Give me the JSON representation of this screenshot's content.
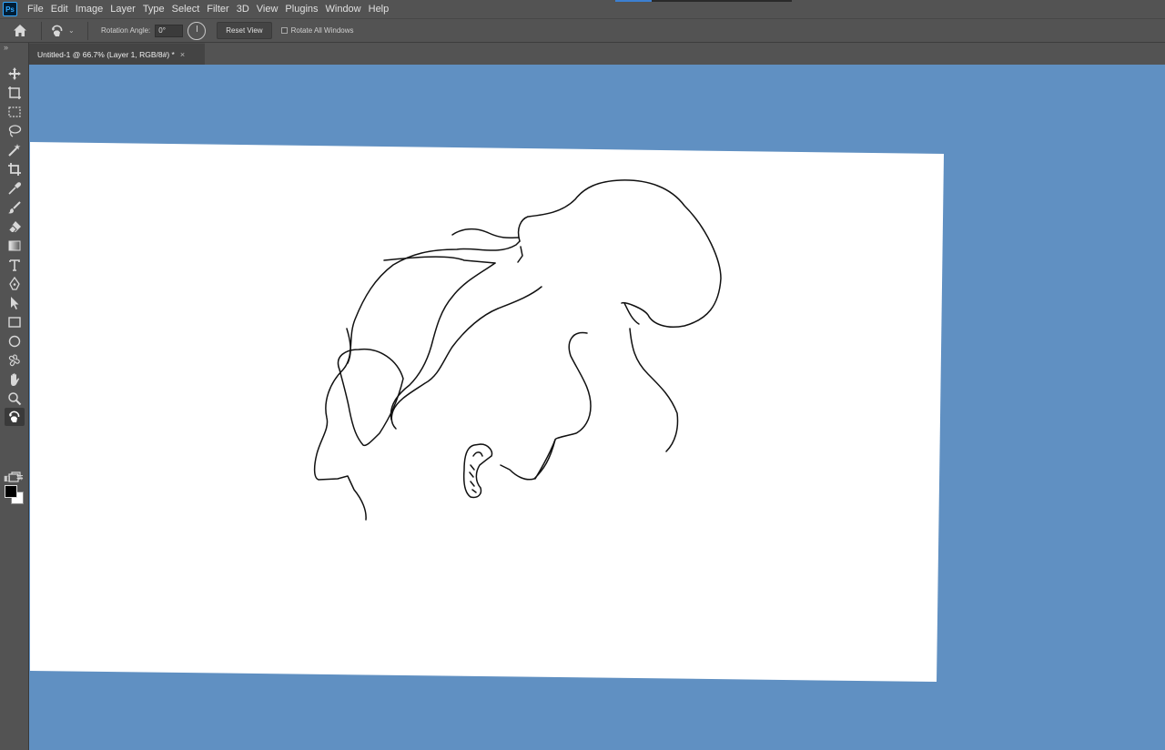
{
  "app": {
    "logo_text": "Ps"
  },
  "menu": [
    "File",
    "Edit",
    "Image",
    "Layer",
    "Type",
    "Select",
    "Filter",
    "3D",
    "View",
    "Plugins",
    "Window",
    "Help"
  ],
  "options": {
    "rotation_label": "Rotation Angle:",
    "rotation_value": "0°",
    "reset_view_label": "Reset View",
    "rotate_all_label": "Rotate All Windows"
  },
  "document": {
    "tab_title": "Untitled-1 @ 66.7% (Layer 1, RGB/8#) *",
    "close_glyph": "×"
  },
  "tools_panel": {
    "collapse_glyph": "»",
    "tools": [
      {
        "name": "move-tool-icon"
      },
      {
        "name": "artboard-tool-icon"
      },
      {
        "name": "rectangular-marquee-icon"
      },
      {
        "name": "lasso-icon"
      },
      {
        "name": "magic-wand-icon"
      },
      {
        "name": "crop-icon"
      },
      {
        "name": "eyedropper-icon"
      },
      {
        "name": "brush-icon"
      },
      {
        "name": "eraser-icon"
      },
      {
        "name": "gradient-icon"
      },
      {
        "name": "type-icon"
      },
      {
        "name": "pen-icon"
      },
      {
        "name": "path-selection-icon"
      },
      {
        "name": "rectangle-shape-icon"
      },
      {
        "name": "ellipse-shape-icon"
      },
      {
        "name": "custom-shape-icon"
      },
      {
        "name": "hand-icon"
      },
      {
        "name": "zoom-icon"
      },
      {
        "name": "rotate-view-icon",
        "active": true
      }
    ],
    "foreground_color": "#000000",
    "background_color": "#ffffff"
  },
  "colors": {
    "workspace_bg": "#6090c2",
    "canvas_bg": "#ffffff",
    "ui_bg": "#535353"
  }
}
